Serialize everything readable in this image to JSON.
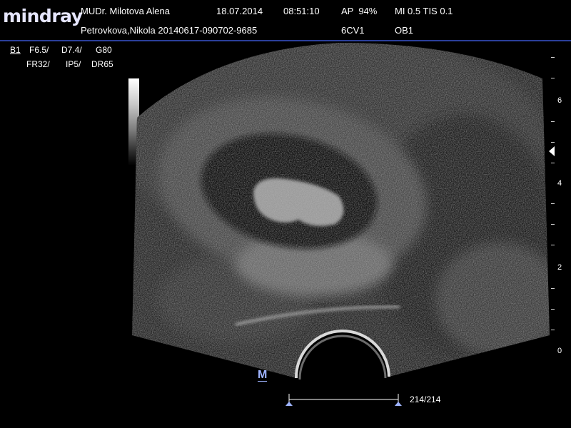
{
  "header": {
    "brand": "mindray",
    "physician": "MUDr. Milotova Alena",
    "date": "18.07.2014",
    "time": "08:51:10",
    "acoustic_power": "AP  94%",
    "mi_tis": "MI 0.5 TIS 0.1",
    "patient": "Petrovkova,Nikola 20140617-090702-9685",
    "probe": "6CV1",
    "exam_preset": "OB1"
  },
  "imaging_params": {
    "mode": "B1",
    "frequency": "F6.5/",
    "depth": "D7.4/",
    "gain": "G80",
    "frame_rate": "FR32/",
    "image_process": "IP5/",
    "dynamic_range": "DR65"
  },
  "depth_scale": {
    "labels": [
      "6",
      "4",
      "2",
      "0"
    ]
  },
  "cine": {
    "marker": "M",
    "frame_counter": "214/214"
  },
  "colors": {
    "header_line": "#2b3f9a",
    "logo": "#e6e6ff",
    "orientation_marker": "#9fb4ff"
  }
}
